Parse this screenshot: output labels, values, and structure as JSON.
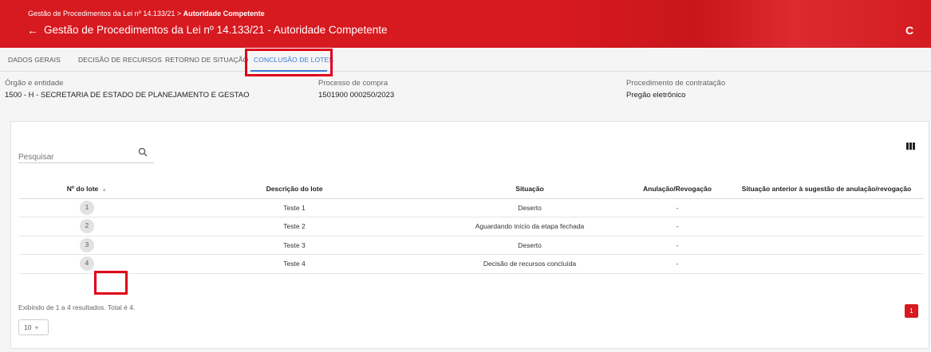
{
  "header": {
    "breadcrumb_prefix": "Gestão de Procedimentos da Lei nº 14.133/21 > ",
    "breadcrumb_current": "Autoridade Competente",
    "back_icon": "←",
    "title": "Gestão de Procedimentos da Lei nº 14.133/21 - Autoridade Competente",
    "refresh_icon": "C",
    "color": "#d71920"
  },
  "tabs": [
    {
      "label": "DADOS GERAIS"
    },
    {
      "label": "DECISÃO DE RECURSOS"
    },
    {
      "label": "RETORNO DE SITUAÇÃO"
    },
    {
      "label": "CONCLUSÃO DE LOTES",
      "active": true
    }
  ],
  "info": {
    "orgao_label": "Órgão e entidade",
    "orgao_value": "1500 - H - SECRETARIA DE ESTADO DE PLANEJAMENTO E GESTAO",
    "processo_label": "Processo de compra",
    "processo_value": "1501900 000250/2023",
    "procedimento_label": "Procedimento de contratação",
    "procedimento_value": "Pregão eletrônico"
  },
  "search": {
    "placeholder": "Pesquisar"
  },
  "table": {
    "headers": [
      "Nº do lote",
      "Descrição do lote",
      "Situação",
      "Anulação/Revogação",
      "Situação anterior à sugestão de anulação/revogação"
    ],
    "rows": [
      {
        "lote": "1",
        "descricao": "Teste 1",
        "situacao": "Deserto",
        "anulacao": "-",
        "anterior": ""
      },
      {
        "lote": "2",
        "descricao": "Teste 2",
        "situacao": "Aguardando início da etapa fechada",
        "anulacao": "-",
        "anterior": ""
      },
      {
        "lote": "3",
        "descricao": "Teste 3",
        "situacao": "Deserto",
        "anulacao": "-",
        "anterior": ""
      },
      {
        "lote": "4",
        "descricao": "Teste 4",
        "situacao": "Decisão de recursos concluída",
        "anulacao": "-",
        "anterior": ""
      }
    ]
  },
  "footer": {
    "results_text": "Exibindo de 1 a 4 resultados. Total é 4.",
    "per_page": "10",
    "current_page": "1"
  }
}
